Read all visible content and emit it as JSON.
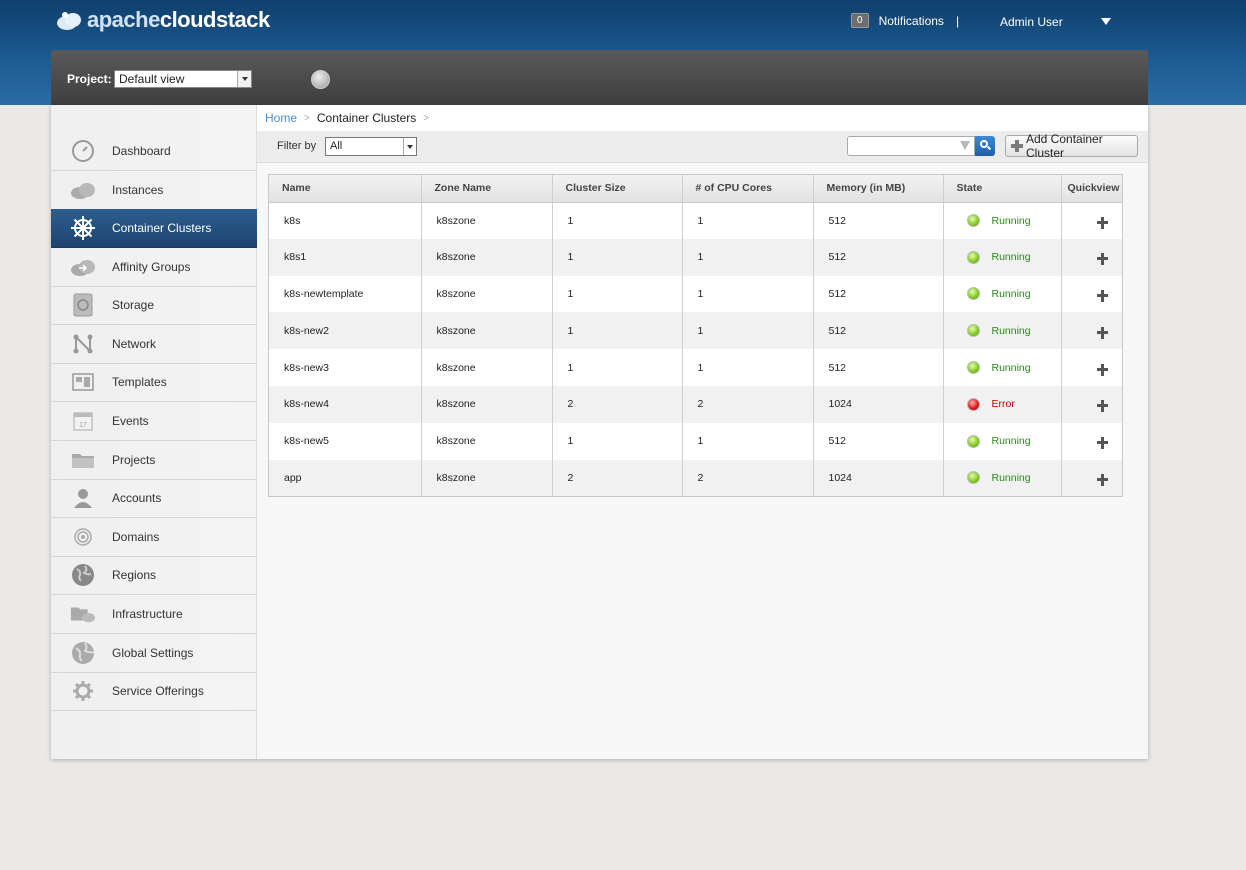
{
  "header": {
    "logo_text_a": "apache",
    "logo_text_b": "cloudstack",
    "notifications_count": "0",
    "notifications_label": "Notifications",
    "separator": "|",
    "user_label": "Admin User"
  },
  "projectbar": {
    "label": "Project:",
    "selected": "Default view"
  },
  "sidebar": {
    "items": [
      {
        "label": "Dashboard",
        "icon": "dashboard-icon"
      },
      {
        "label": "Instances",
        "icon": "instances-cloud-icon"
      },
      {
        "label": "Container Clusters",
        "icon": "helm-wheel-icon",
        "active": true
      },
      {
        "label": "Affinity Groups",
        "icon": "affinity-cloud-icon"
      },
      {
        "label": "Storage",
        "icon": "storage-disk-icon"
      },
      {
        "label": "Network",
        "icon": "network-icon"
      },
      {
        "label": "Templates",
        "icon": "templates-icon"
      },
      {
        "label": "Events",
        "icon": "calendar-icon"
      },
      {
        "label": "Projects",
        "icon": "folder-icon"
      },
      {
        "label": "Accounts",
        "icon": "user-icon"
      },
      {
        "label": "Domains",
        "icon": "domains-target-icon"
      },
      {
        "label": "Regions",
        "icon": "globe-icon"
      },
      {
        "label": "Infrastructure",
        "icon": "infrastructure-icon"
      },
      {
        "label": "Global Settings",
        "icon": "global-settings-icon"
      },
      {
        "label": "Service Offerings",
        "icon": "gear-icon"
      }
    ]
  },
  "breadcrumb": {
    "home": "Home",
    "sep1": ">",
    "current": "Container Clusters",
    "sep2": ">"
  },
  "toolbar": {
    "filter_label": "Filter by",
    "filter_value": "All",
    "add_label": "Add Container Cluster"
  },
  "table": {
    "columns": [
      "Name",
      "Zone Name",
      "Cluster Size",
      "# of CPU Cores",
      "Memory (in MB)",
      "State",
      "Quickview"
    ],
    "rows": [
      {
        "name": "k8s",
        "zone": "k8szone",
        "size": "1",
        "cpu": "1",
        "memory": "512",
        "state": "Running"
      },
      {
        "name": "k8s1",
        "zone": "k8szone",
        "size": "1",
        "cpu": "1",
        "memory": "512",
        "state": "Running"
      },
      {
        "name": "k8s-newtemplate",
        "zone": "k8szone",
        "size": "1",
        "cpu": "1",
        "memory": "512",
        "state": "Running"
      },
      {
        "name": "k8s-new2",
        "zone": "k8szone",
        "size": "1",
        "cpu": "1",
        "memory": "512",
        "state": "Running"
      },
      {
        "name": "k8s-new3",
        "zone": "k8szone",
        "size": "1",
        "cpu": "1",
        "memory": "512",
        "state": "Running"
      },
      {
        "name": "k8s-new4",
        "zone": "k8szone",
        "size": "2",
        "cpu": "2",
        "memory": "1024",
        "state": "Error"
      },
      {
        "name": "k8s-new5",
        "zone": "k8szone",
        "size": "1",
        "cpu": "1",
        "memory": "512",
        "state": "Running"
      },
      {
        "name": "app",
        "zone": "k8szone",
        "size": "2",
        "cpu": "2",
        "memory": "1024",
        "state": "Running"
      }
    ]
  },
  "colors": {
    "header_blue": "#1d5a90",
    "active_nav": "#2d5d8e",
    "running": "#2a8a1a",
    "error": "#c00000",
    "link": "#4a90d6"
  }
}
